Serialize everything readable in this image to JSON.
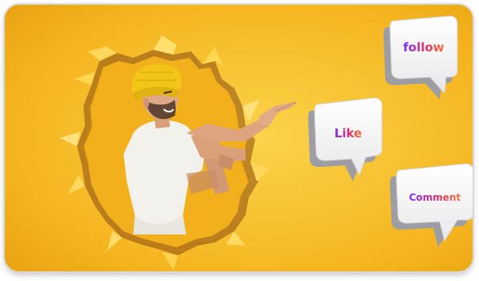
{
  "bubbles": {
    "follow": "follow",
    "like": "Like",
    "comment": "Comment"
  },
  "colors": {
    "background": "#f5b724",
    "gradient_start": "#7b2ff7",
    "gradient_mid": "#e1306c",
    "gradient_end": "#f77737"
  }
}
